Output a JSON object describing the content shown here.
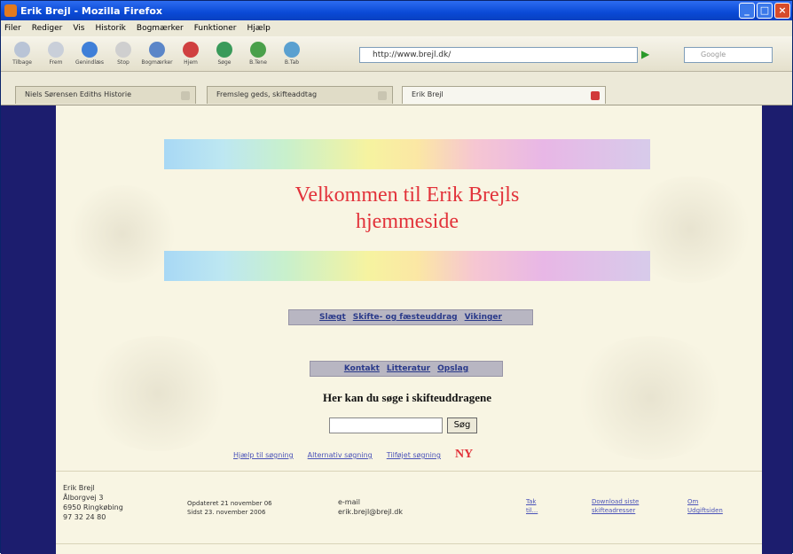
{
  "window": {
    "title": "Erik Brejl - Mozilla Firefox"
  },
  "menu": [
    "Filer",
    "Rediger",
    "Vis",
    "Historik",
    "Bogmærker",
    "Funktioner",
    "Hjælp"
  ],
  "toolbar": {
    "buttons": [
      "Tilbage",
      "Frem",
      "Genindlæs",
      "Stop",
      "Bogmærker",
      "Hjem",
      "Søge",
      "B.Tene",
      "B.Tab"
    ],
    "address": "http://www.brejl.dk/",
    "search_placeholder": "Google"
  },
  "tabs": [
    {
      "label": "Niels Sørensen Ediths Historie",
      "active": false
    },
    {
      "label": "Fremsleg geds, skifteaddtag",
      "active": false
    },
    {
      "label": "Erik Brejl",
      "active": true
    }
  ],
  "page": {
    "welcome_line1": "Velkommen til Erik Brejls",
    "welcome_line2": "hjemmeside",
    "nav1": [
      "Slægt",
      "Skifte- og fæsteuddrag",
      "Vikinger"
    ],
    "nav2": [
      "Kontakt",
      "Litteratur",
      "Opslag"
    ],
    "search_label": "Her kan du søge i skifteuddragene",
    "search_button": "Søg",
    "links": [
      "Hjælp til søgning",
      "Alternativ søgning",
      "Tilføjet søgning"
    ],
    "new_badge": "NY"
  },
  "footer": {
    "name": "Erik Brejl",
    "street": "Ålborgvej 3",
    "city": "6950 Ringkøbing",
    "phone": "97 32 24 80",
    "date1": "Opdateret 21 november 06",
    "date2": "Sidst 23. november 2006",
    "email_label": "e-mail",
    "email": "erik.brejl@brejl.dk",
    "link1a": "Tak",
    "link1b": "til...",
    "link2a": "Download siste",
    "link2b": "skifteadresser",
    "link3a": "Om",
    "link3b": "Udgiftsiden"
  },
  "colors": {
    "title_red": "#e2323a",
    "page_bg": "#f8f5e3",
    "frame_bg": "#1c1d6e"
  }
}
